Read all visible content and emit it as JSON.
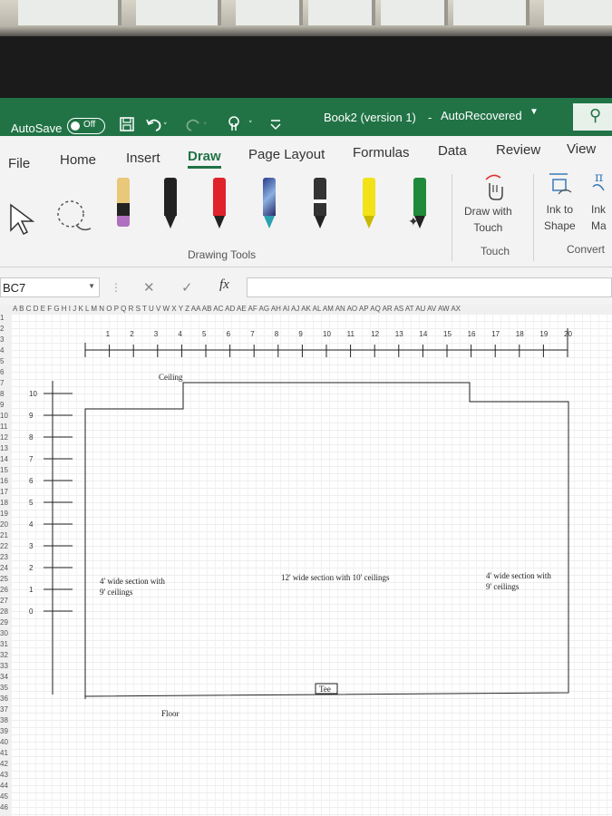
{
  "title_bar": {
    "autosave_label": "AutoSave",
    "autosave_state": "Off",
    "document_title": "Book2 (version 1)",
    "separator": "-",
    "status": "AutoRecovered"
  },
  "tabs": [
    {
      "label": "File"
    },
    {
      "label": "Home"
    },
    {
      "label": "Insert"
    },
    {
      "label": "Draw",
      "active": true
    },
    {
      "label": "Page Layout"
    },
    {
      "label": "Formulas"
    },
    {
      "label": "Data"
    },
    {
      "label": "Review"
    },
    {
      "label": "View"
    }
  ],
  "ribbon": {
    "drawing_tools_label": "Drawing Tools",
    "draw_with_touch": [
      "Draw with",
      "Touch"
    ],
    "touch_label": "Touch",
    "ink_to_shape": [
      "Ink to",
      "Shape"
    ],
    "ink_math": [
      "Ink",
      "Ma"
    ],
    "convert_label": "Convert",
    "pens": [
      {
        "name": "pencil-icon",
        "color": "#e9c87a"
      },
      {
        "name": "black-pen-icon",
        "color": "#222222"
      },
      {
        "name": "red-pen-icon",
        "color": "#e0222a"
      },
      {
        "name": "galaxy-pen-icon",
        "color": "#3a4a9a"
      },
      {
        "name": "wave-pen-icon",
        "color": "#333333"
      },
      {
        "name": "yellow-highlighter-icon",
        "color": "#f2e21a"
      },
      {
        "name": "green-highlighter-icon",
        "color": "#1e8a3a"
      }
    ]
  },
  "formula_bar": {
    "name_box": "BC7",
    "fx": "fx",
    "cancel": "✕",
    "enter": "✓"
  },
  "sheet": {
    "columns_text": "A B C D E F G H I J K L M N O P Q R S T U V W X Y Z AA AB AC AD AE AF AG AH AI AJ AK AL AM AN AO AP AQ AR AS AT AU AV AW AX",
    "row_numbers": [
      "1",
      "2",
      "3",
      "4",
      "5",
      "6",
      "7",
      "8",
      "9",
      "10",
      "11",
      "12",
      "13",
      "14",
      "15",
      "16",
      "17",
      "18",
      "19",
      "20",
      "21",
      "22",
      "23",
      "24",
      "25",
      "26",
      "27",
      "28",
      "29",
      "30",
      "31",
      "32",
      "33",
      "34",
      "35",
      "36",
      "37",
      "38",
      "39",
      "40",
      "41",
      "42",
      "43",
      "44",
      "45",
      "46"
    ],
    "ruler_numbers": [
      "1",
      "2",
      "3",
      "4",
      "5",
      "6",
      "7",
      "8",
      "9",
      "10",
      "11",
      "12",
      "13",
      "14",
      "15",
      "16",
      "17",
      "18",
      "19",
      "20"
    ],
    "height_numbers": [
      "10",
      "9",
      "8",
      "7",
      "6",
      "5",
      "4",
      "3",
      "2",
      "1",
      "0"
    ],
    "labels": {
      "ceiling": "Ceiling",
      "floor": "Floor",
      "tee": "Tee",
      "left_section": [
        "4' wide section with",
        "9' ceilings"
      ],
      "middle_section": "12' wide section with 10' ceilings",
      "right_section": [
        "4' wide section with",
        "9' ceilings"
      ]
    }
  },
  "colors": {
    "brand_green": "#217346",
    "ribbon_bg": "#f3f3f3"
  }
}
